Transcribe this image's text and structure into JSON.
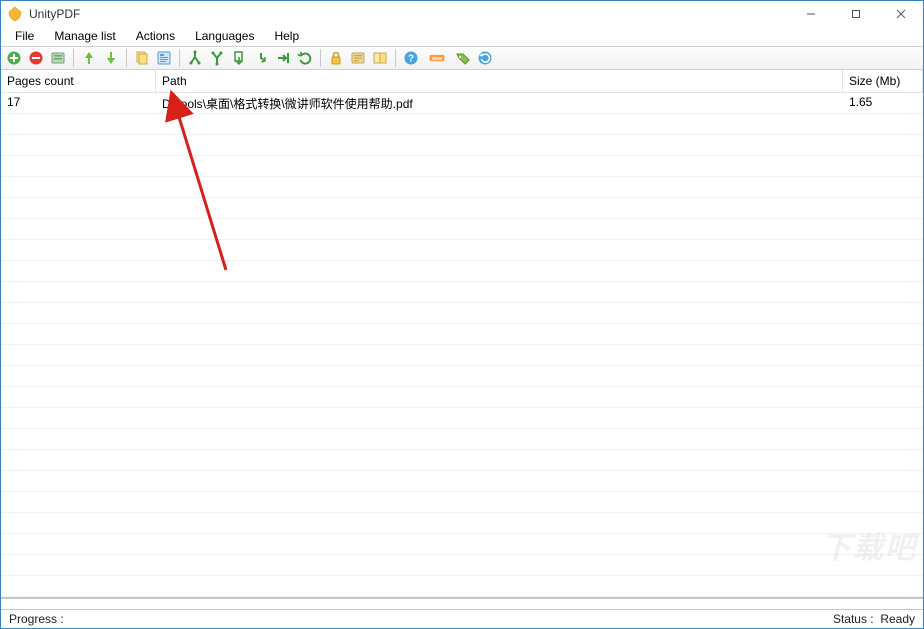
{
  "window": {
    "title": "UnityPDF"
  },
  "menu": {
    "items": [
      "File",
      "Manage list",
      "Actions",
      "Languages",
      "Help"
    ]
  },
  "toolbar": {
    "icons": [
      "add-icon",
      "remove-icon",
      "save-list-icon",
      "sep",
      "arrow-up-icon",
      "arrow-down-icon",
      "sep",
      "copy-icon",
      "properties-icon",
      "sep",
      "split-icon",
      "merge-icon",
      "extract-pages-icon",
      "rotate-icon",
      "insert-icon",
      "undo-rotate-icon",
      "sep",
      "lock-icon",
      "metadata-icon",
      "compare-icon",
      "sep",
      "help-icon",
      "new-badge-icon",
      "tag-icon",
      "refresh-icon"
    ]
  },
  "columns": {
    "pages": "Pages count",
    "path": "Path",
    "size": "Size (Mb)"
  },
  "rows": [
    {
      "pages": "17",
      "path": "D:\\tools\\桌面\\格式转换\\微讲师软件使用帮助.pdf",
      "size": "1.65"
    }
  ],
  "status": {
    "progress_label": "Progress :",
    "status_label": "Status :",
    "status_value": "Ready"
  },
  "watermark": "下载吧"
}
